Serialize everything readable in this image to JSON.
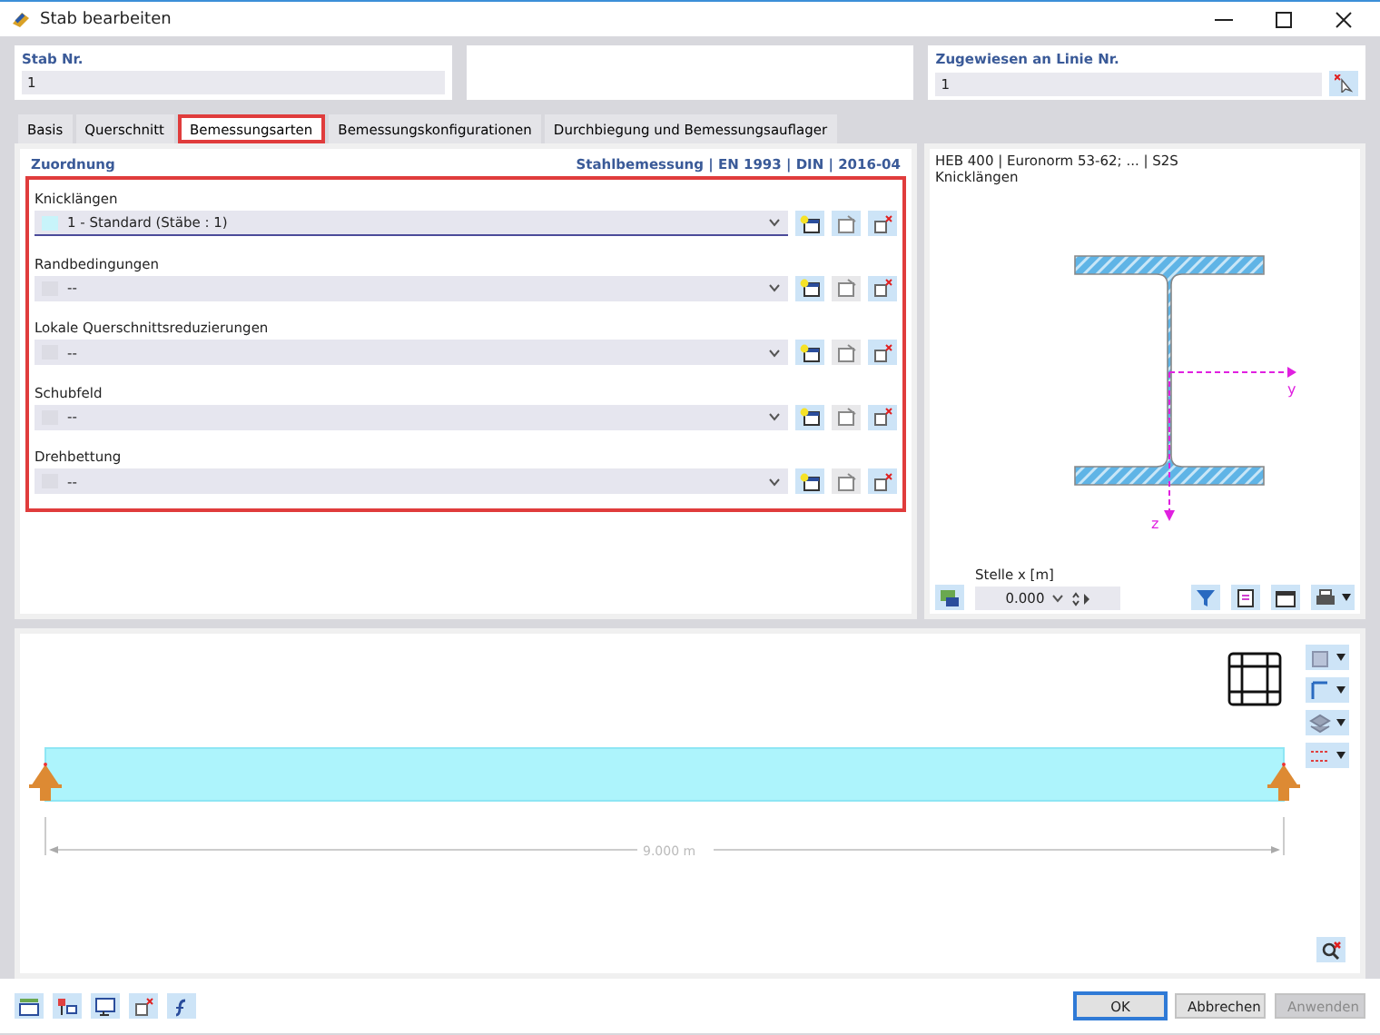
{
  "window": {
    "title": "Stab bearbeiten"
  },
  "header": {
    "member": {
      "label": "Stab Nr.",
      "value": "1"
    },
    "line": {
      "label": "Zugewiesen an Linie Nr.",
      "value": "1"
    }
  },
  "tabs": [
    {
      "label": "Basis",
      "selected": false
    },
    {
      "label": "Querschnitt",
      "selected": false
    },
    {
      "label": "Bemessungsarten",
      "selected": true
    },
    {
      "label": "Bemessungskonfigurationen",
      "selected": false
    },
    {
      "label": "Durchbiegung und Bemessungsauflager",
      "selected": false
    }
  ],
  "assignment": {
    "title": "Zuordnung",
    "standard": "Stahlbemessung | EN 1993 | DIN | 2016-04",
    "fields": [
      {
        "label": "Knicklängen",
        "value": "1 - Standard (Stäbe : 1)",
        "color": "#c8f4fa",
        "edit_enabled": true
      },
      {
        "label": "Randbedingungen",
        "value": "--",
        "color": "#dcdce4",
        "edit_enabled": false
      },
      {
        "label": "Lokale Querschnittsreduzierungen",
        "value": "--",
        "color": "#dcdce4",
        "edit_enabled": false
      },
      {
        "label": "Schubfeld",
        "value": "--",
        "color": "#dcdce4",
        "edit_enabled": false
      },
      {
        "label": "Drehbettung",
        "value": "--",
        "color": "#dcdce4",
        "edit_enabled": false
      }
    ]
  },
  "section": {
    "title": "HEB 400 | Euronorm 53-62; ... | S2S",
    "subtitle": "Knicklängen",
    "axis_y": "y",
    "axis_z": "z",
    "location": {
      "label": "Stelle x [m]",
      "value": "0.000"
    }
  },
  "model": {
    "dimension": "9.000 m"
  },
  "buttons": [
    {
      "label": "OK",
      "kind": "default",
      "disabled": false
    },
    {
      "label": "Abbrechen",
      "kind": "normal",
      "disabled": false
    },
    {
      "label": "Anwenden",
      "kind": "normal",
      "disabled": true
    }
  ]
}
